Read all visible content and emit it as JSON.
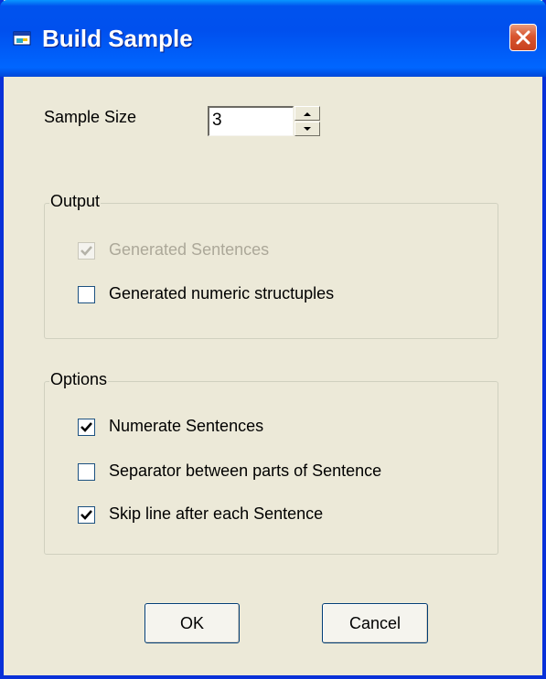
{
  "window": {
    "title": "Build Sample"
  },
  "sample_size": {
    "label": "Sample Size",
    "value": "3"
  },
  "output": {
    "legend": "Output",
    "options": [
      {
        "label": "Generated Sentences",
        "checked": true,
        "disabled": true
      },
      {
        "label": "Generated numeric structuples",
        "checked": false,
        "disabled": false
      }
    ]
  },
  "options": {
    "legend": "Options",
    "items": [
      {
        "label": "Numerate Sentences",
        "checked": true
      },
      {
        "label": "Separator between parts of Sentence",
        "checked": false
      },
      {
        "label": "Skip line after each Sentence",
        "checked": true
      }
    ]
  },
  "buttons": {
    "ok": "OK",
    "cancel": "Cancel"
  },
  "colors": {
    "titlebar": "#0054e3",
    "close": "#d8552f",
    "face": "#ece9d8"
  },
  "icons": {
    "title": "app-window-icon",
    "close": "close-icon"
  }
}
